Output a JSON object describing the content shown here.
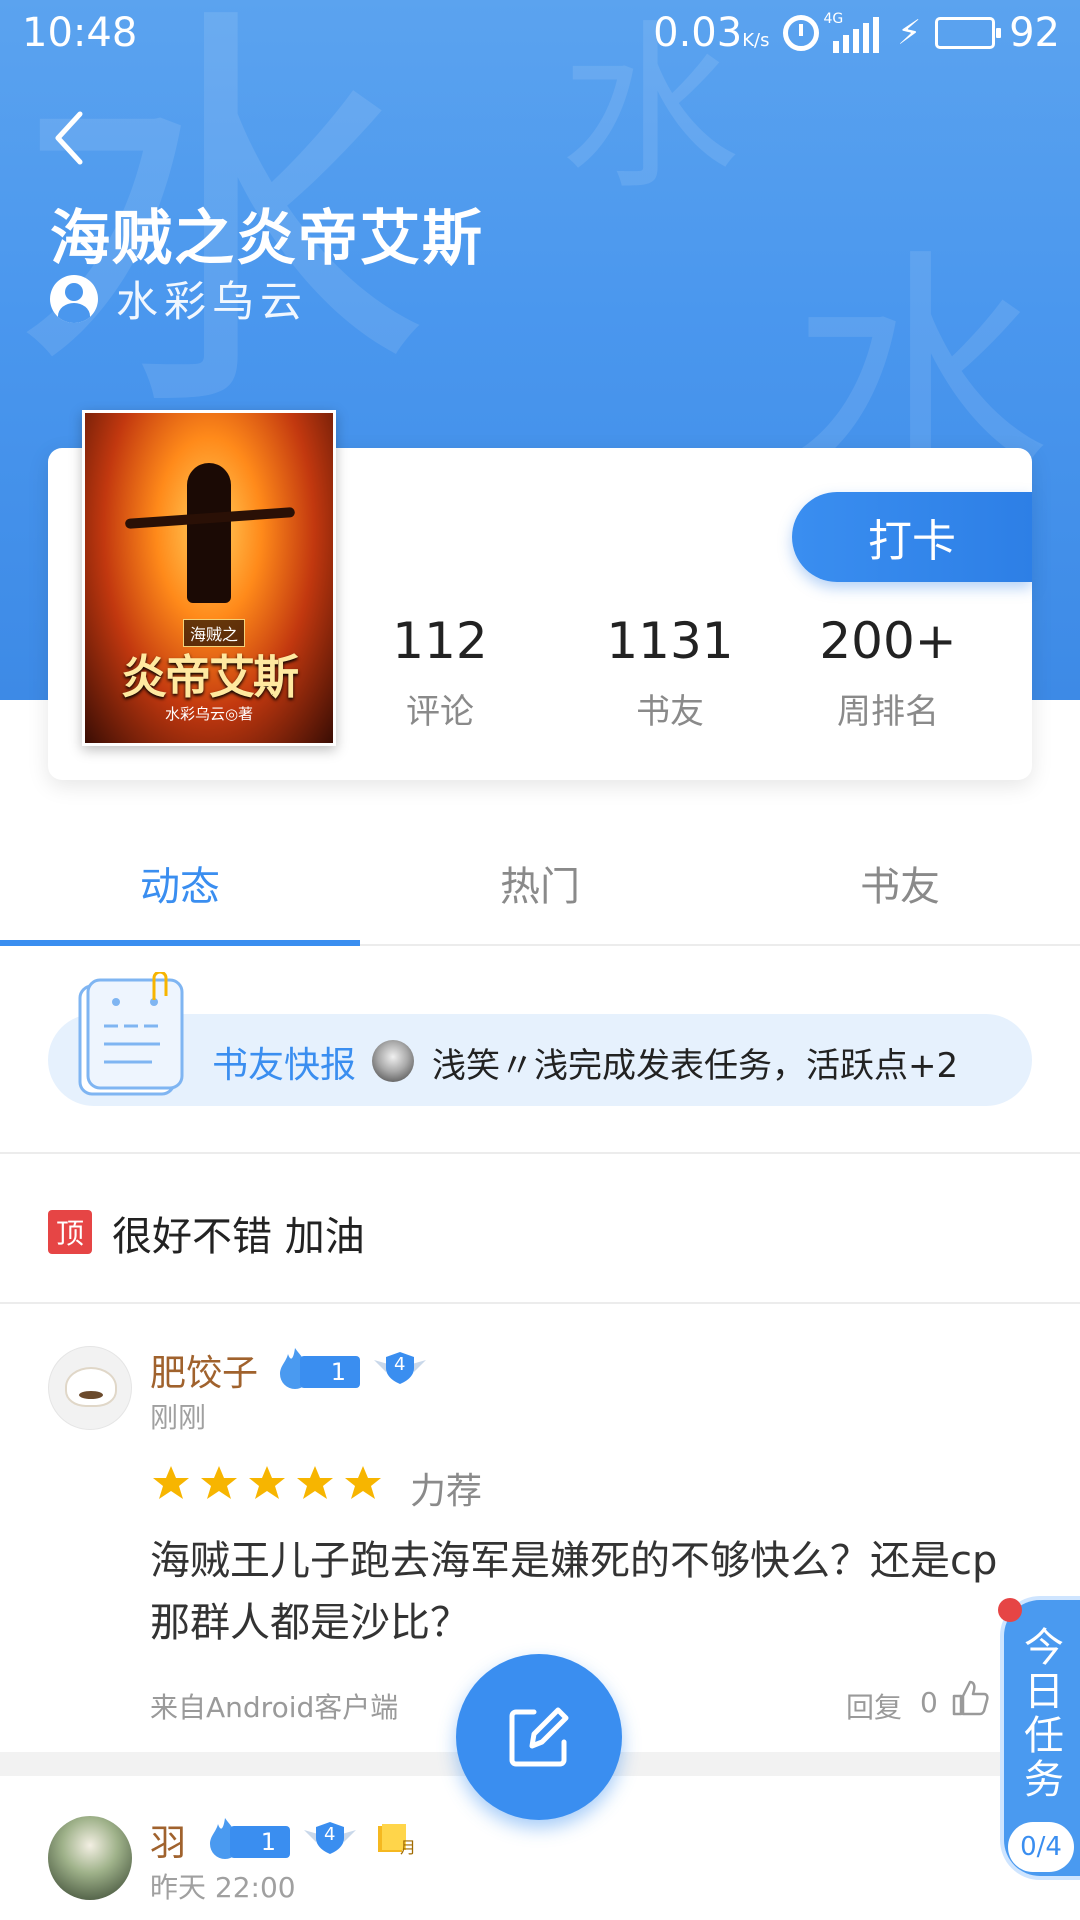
{
  "status_bar": {
    "time": "10:48",
    "net_speed": "0.03",
    "net_unit": "K/s",
    "network": "4G",
    "battery": "92"
  },
  "header": {
    "book_title": "海贼之炎帝艾斯",
    "author": "水彩乌云",
    "watermark_char": "水"
  },
  "cover": {
    "subtitle": "海贼之",
    "title": "炎帝艾斯",
    "author_line": "水彩乌云◎著"
  },
  "checkin_label": "打卡",
  "stats": [
    {
      "value": "112",
      "label": "评论"
    },
    {
      "value": "1131",
      "label": "书友"
    },
    {
      "value": "200+",
      "label": "周排名"
    }
  ],
  "tabs": [
    {
      "label": "动态",
      "active": true
    },
    {
      "label": "热门",
      "active": false
    },
    {
      "label": "书友",
      "active": false
    }
  ],
  "flash_news": {
    "label": "书友快报",
    "text": "浅笑〃浅完成发表任务，活跃点+2"
  },
  "pinned": {
    "badge": "顶",
    "text": "很好不错 加油"
  },
  "posts": [
    {
      "username": "肥饺子",
      "level": "1",
      "shield_level": "4",
      "time": "刚刚",
      "stars": 5,
      "rating_text": "力荐",
      "body": "海贼王儿子跑去海军是嫌死的不够快么？还是cp那群人都是沙比？",
      "source": "来自Android客户端",
      "reply_label": "回复",
      "reply_count": "0",
      "like_label": "赞"
    },
    {
      "username": "羽",
      "level": "1",
      "shield_level": "4",
      "monthly_badge": "月",
      "time": "昨天 22:00"
    }
  ],
  "daily_task": {
    "label": "今日任务",
    "progress": "0/4"
  },
  "colors": {
    "accent": "#3a8ef0",
    "header_top": "#5ba3ef",
    "username": "#a0622d",
    "pin": "#e64545",
    "star": "#f7b500"
  }
}
